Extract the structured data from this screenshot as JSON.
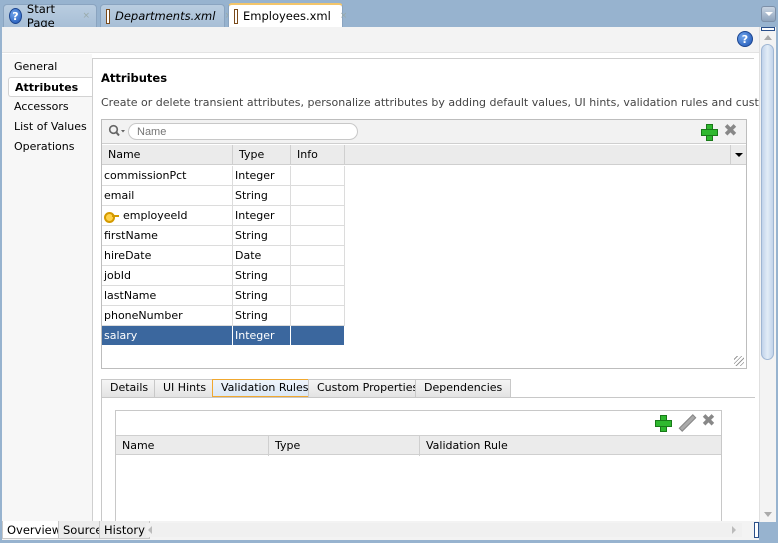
{
  "doc_tabs": [
    {
      "label": "Start Page",
      "icon": "help-circle-icon",
      "italic": false,
      "active": false
    },
    {
      "label": "Departments.xml",
      "icon": "xml-file-icon",
      "italic": true,
      "active": false
    },
    {
      "label": "Employees.xml",
      "icon": "xml-file-icon",
      "italic": false,
      "active": true
    }
  ],
  "close_glyph": "×",
  "help_glyph": "?",
  "nav": {
    "items": [
      {
        "label": "General",
        "active": false
      },
      {
        "label": "Attributes",
        "active": true
      },
      {
        "label": "Accessors",
        "active": false
      },
      {
        "label": "List of Values",
        "active": false
      },
      {
        "label": "Operations",
        "active": false
      }
    ]
  },
  "section": {
    "title": "Attributes",
    "description": "Create or delete transient attributes, personalize attributes by adding default values, UI hints, validation rules and custom properties."
  },
  "search": {
    "placeholder": "Name",
    "value": ""
  },
  "toolbar": {
    "add_icon": "green-plus-icon",
    "delete_icon": "gray-x-icon",
    "delete_glyph": "✖"
  },
  "attributes_table": {
    "columns": [
      "Name",
      "Type",
      "Info"
    ],
    "rows": [
      {
        "name": "commissionPct",
        "type": "Integer",
        "info": "",
        "key": false,
        "selected": false
      },
      {
        "name": "email",
        "type": "String",
        "info": "",
        "key": false,
        "selected": false
      },
      {
        "name": "employeeId",
        "type": "Integer",
        "info": "",
        "key": true,
        "selected": false
      },
      {
        "name": "firstName",
        "type": "String",
        "info": "",
        "key": false,
        "selected": false
      },
      {
        "name": "hireDate",
        "type": "Date",
        "info": "",
        "key": false,
        "selected": false
      },
      {
        "name": "jobId",
        "type": "String",
        "info": "",
        "key": false,
        "selected": false
      },
      {
        "name": "lastName",
        "type": "String",
        "info": "",
        "key": false,
        "selected": false
      },
      {
        "name": "phoneNumber",
        "type": "String",
        "info": "",
        "key": false,
        "selected": false
      },
      {
        "name": "salary",
        "type": "Integer",
        "info": "",
        "key": false,
        "selected": true
      }
    ]
  },
  "detail_tabs": [
    {
      "label": "Details",
      "active": false
    },
    {
      "label": "UI Hints",
      "active": false
    },
    {
      "label": "Validation Rules",
      "active": true
    },
    {
      "label": "Custom Properties",
      "active": false
    },
    {
      "label": "Dependencies",
      "active": false
    }
  ],
  "validation_table": {
    "columns": [
      "Name",
      "Type",
      "Validation Rule"
    ],
    "rows": []
  },
  "bottom_tabs": [
    {
      "label": "Overview",
      "active": true
    },
    {
      "label": "Source",
      "active": false
    },
    {
      "label": "History",
      "active": false
    }
  ],
  "colors": {
    "selection": "#3b679e",
    "window_frame": "#97b3cf",
    "active_tab_accent": "#f0a830",
    "add_green": "#2fb82f"
  }
}
